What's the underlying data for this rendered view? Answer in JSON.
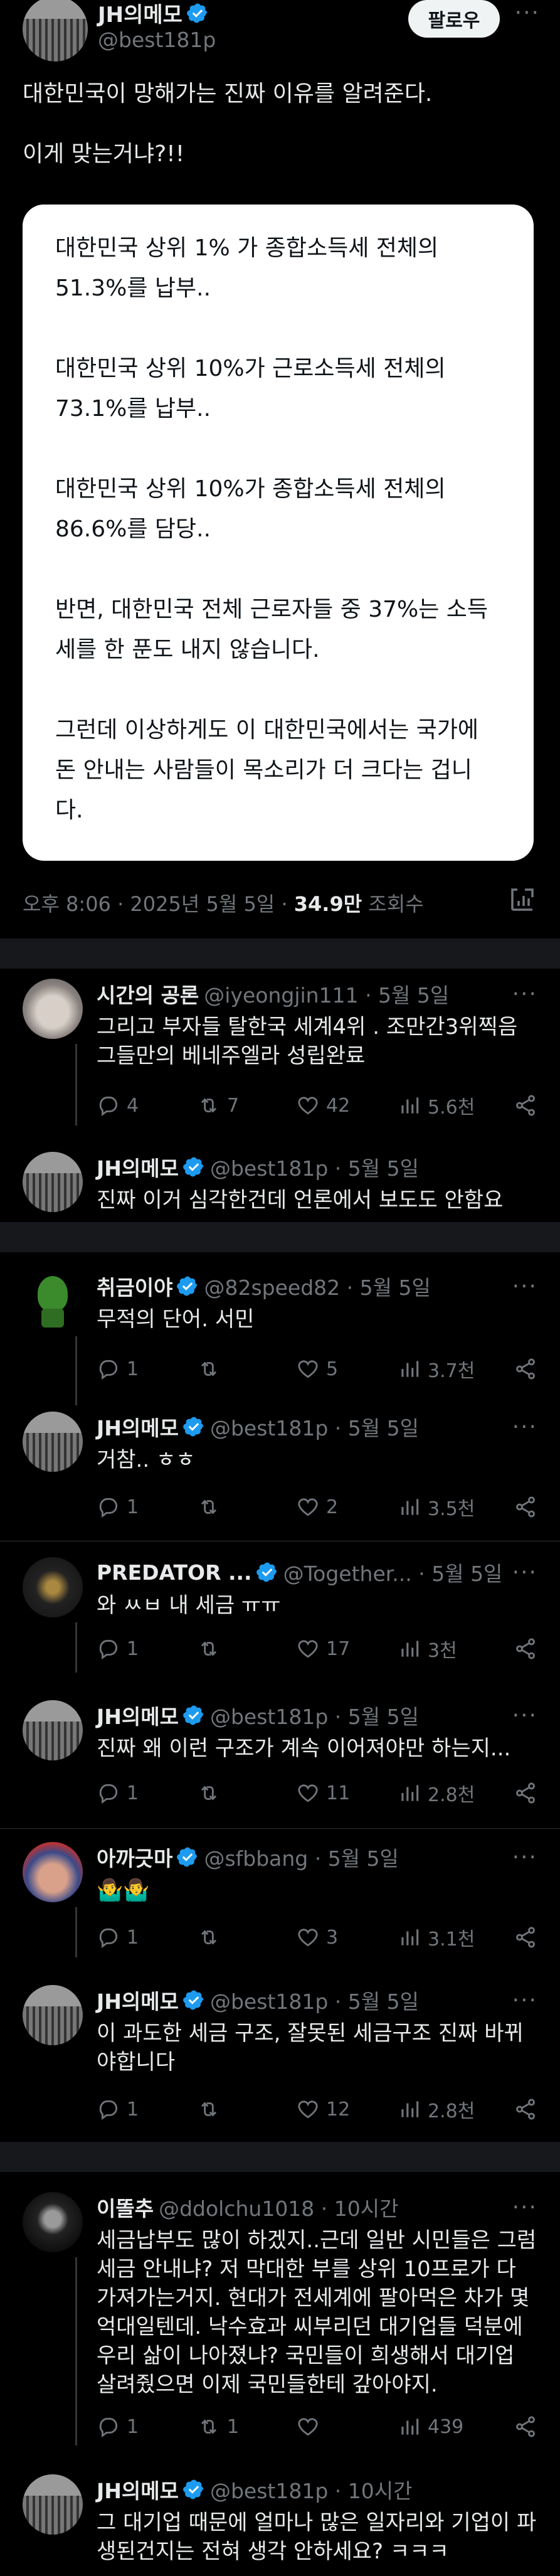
{
  "main_post": {
    "author_name": "JH의메모",
    "author_handle": "@best181p",
    "follow_label": "팔로우",
    "text": "대한민국이 망해가는 진짜 이유를 알려준다.\n\n이게 맞는거냐?!!",
    "card_paragraphs": [
      "대한민국 상위 1% 가 종합소득세 전체의 51.3%를 납부..",
      "대한민국 상위 10%가 근로소득세 전체의 73.1%를 납부..",
      "대한민국 상위 10%가 종합소득세 전체의 86.6%를 담당..",
      "반면, 대한민국 전체 근로자들 중 37%는 소득세를 한 푼도 내지 않습니다.",
      "그런데 이상하게도 이 대한민국에서는 국가에 돈 안내는 사람들이 목소리가 더 크다는 겁니다."
    ],
    "time": "오후 8:06 · 2025년 5월 5일 · ",
    "views": "34.9만",
    "views_label": " 조회수"
  },
  "replies": [
    {
      "name": "시간의 공론",
      "handle": "@iyeongjin111 · 5월 5일",
      "text": "그리고 부자들 탈한국 세계4위 . 조만간3위찍음 그들만의 베네주엘라 성립완료",
      "reply": "4",
      "retweet": "7",
      "like": "42",
      "views": "5.6천",
      "verified": false
    },
    {
      "name": "JH의메모",
      "handle": "@best181p · 5월 5일",
      "text": "진짜 이거 심각한건데 언론에서 보도도 안함요",
      "verified": true
    },
    {
      "name": "취금이야",
      "handle": "@82speed82 · 5월 5일",
      "text": "무적의 단어. 서민",
      "reply": "1",
      "retweet": "",
      "like": "5",
      "views": "3.7천",
      "verified": true
    },
    {
      "name": "JH의메모",
      "handle": "@best181p · 5월 5일",
      "text": "거참.. ㅎㅎ",
      "reply": "1",
      "retweet": "",
      "like": "2",
      "views": "3.5천",
      "verified": true
    },
    {
      "name": "PREDATOR ...",
      "handle": "@Together... · 5월 5일",
      "text": "와 ㅆㅂ 내 세금 ㅠㅠ",
      "reply": "1",
      "retweet": "",
      "like": "17",
      "views": "3천",
      "verified": true
    },
    {
      "name": "JH의메모",
      "handle": "@best181p · 5월 5일",
      "text": "진짜 왜 이런 구조가 계속 이어져야만 하는지...",
      "reply": "1",
      "retweet": "",
      "like": "11",
      "views": "2.8천",
      "verified": true
    },
    {
      "name": "아까긋마",
      "handle": "@sfbbang · 5월 5일",
      "text": "🤷‍♂️🤷‍♂️",
      "reply": "1",
      "retweet": "",
      "like": "3",
      "views": "3.1천",
      "verified": true
    },
    {
      "name": "JH의메모",
      "handle": "@best181p · 5월 5일",
      "text": "이 과도한 세금 구조, 잘못된 세금구조 진짜 바뀌야합니다",
      "reply": "1",
      "retweet": "",
      "like": "12",
      "views": "2.8천",
      "verified": true
    },
    {
      "name": "이똘추",
      "handle": "@ddolchu1018 · 10시간",
      "text": "세금납부도 많이 하겠지..근데 일반 시민들은 그럼 세금 안내냐? 저 막대한 부를 상위 10프로가 다 가져가는거지. 현대가 전세계에 팔아먹은 차가 몇억대일텐데. 낙수효과 씨부리던 대기업들 덕분에 우리 삶이 나아졌냐? 국민들이 희생해서 대기업 살려줬으면 이제 국민들한테 갚아야지.",
      "reply": "1",
      "retweet": "1",
      "like": "",
      "views": "439",
      "verified": false
    },
    {
      "name": "JH의메모",
      "handle": "@best181p · 10시간",
      "text": "그 대기업 때문에 얼마나 많은 일자리와 기업이 파생된건지는 전혀 생각 안하세요? ㅋㅋㅋ",
      "verified": true
    }
  ],
  "icons": {
    "verified_color": "#1d9bf0",
    "more": "more-dots-icon",
    "reply": "reply-bubble-icon",
    "retweet": "retweet-icon",
    "like": "heart-icon",
    "views": "views-chart-icon",
    "share": "share-icon",
    "analytics": "analytics-icon"
  },
  "colors": {
    "background": "#000000",
    "text": "#e7e9ea",
    "muted": "#71767b",
    "card": "#ffffff",
    "band": "#16181c"
  }
}
